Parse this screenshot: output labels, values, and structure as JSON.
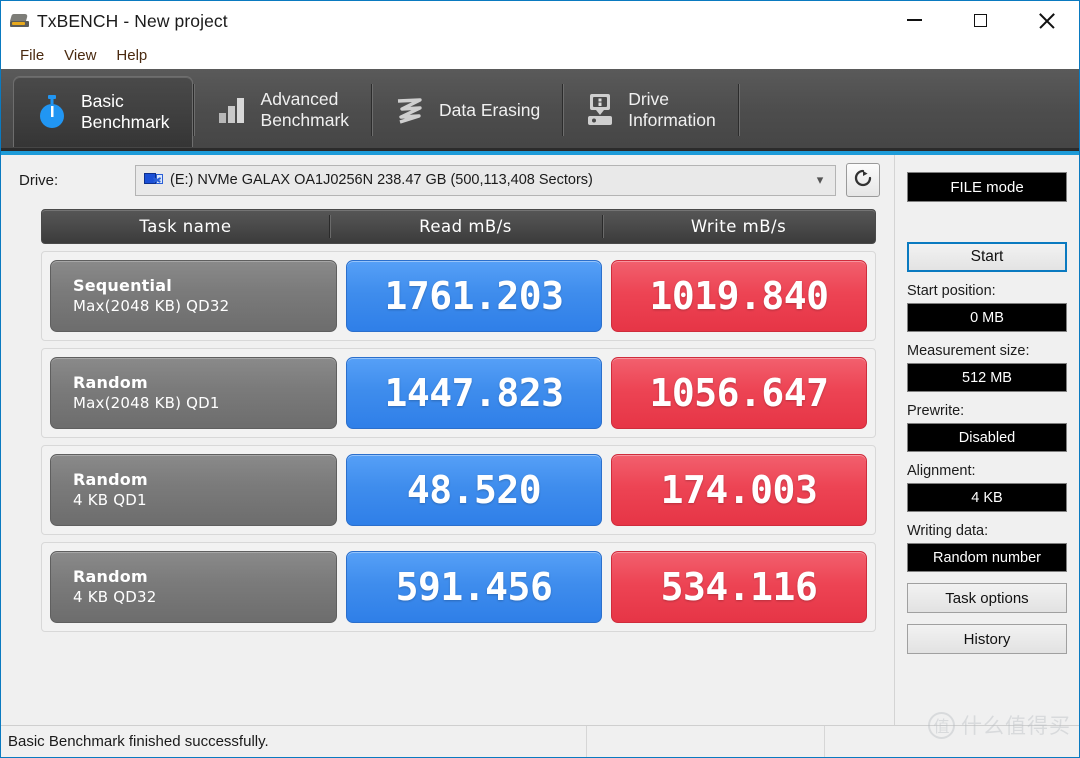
{
  "window": {
    "title": "TxBENCH - New project",
    "icon": "drive-app-icon",
    "controls": {
      "minimize": "minimize-icon",
      "maximize": "maximize-icon",
      "close": "close-icon"
    }
  },
  "menubar": {
    "items": [
      "File",
      "View",
      "Help"
    ]
  },
  "tabs": [
    {
      "icon": "stopwatch-icon",
      "line1": "Basic",
      "line2": "Benchmark",
      "active": true
    },
    {
      "icon": "bar-chart-icon",
      "line1": "Advanced",
      "line2": "Benchmark",
      "active": false
    },
    {
      "icon": "scribble-icon",
      "line1": "Data Erasing",
      "line2": "",
      "active": false
    },
    {
      "icon": "drive-info-icon",
      "line1": "Drive",
      "line2": "Information",
      "active": false
    }
  ],
  "drive": {
    "label": "Drive:",
    "icon": "network-drive-icon",
    "value": "(E:) NVMe GALAX OA1J0256N  238.47 GB (500,113,408 Sectors)",
    "caret": "chevron-down-icon",
    "refresh": "refresh-icon"
  },
  "table": {
    "headers": [
      "Task name",
      "Read mB/s",
      "Write mB/s"
    ],
    "rows": [
      {
        "name_line1": "Sequential",
        "name_line2": "Max(2048 KB) QD32",
        "read": "1761.203",
        "write": "1019.840"
      },
      {
        "name_line1": "Random",
        "name_line2": "Max(2048 KB) QD1",
        "read": "1447.823",
        "write": "1056.647"
      },
      {
        "name_line1": "Random",
        "name_line2": "4 KB QD1",
        "read": "48.520",
        "write": "174.003"
      },
      {
        "name_line1": "Random",
        "name_line2": "4 KB QD32",
        "read": "591.456",
        "write": "534.116"
      }
    ]
  },
  "panel": {
    "mode": "FILE mode",
    "start": "Start",
    "start_position_label": "Start position:",
    "start_position_value": "0 MB",
    "measurement_size_label": "Measurement size:",
    "measurement_size_value": "512 MB",
    "prewrite_label": "Prewrite:",
    "prewrite_value": "Disabled",
    "alignment_label": "Alignment:",
    "alignment_value": "4 KB",
    "writing_data_label": "Writing data:",
    "writing_data_value": "Random number",
    "task_options": "Task options",
    "history": "History"
  },
  "status": {
    "message": "Basic Benchmark finished successfully.",
    "cell2": "",
    "cell3": ""
  },
  "watermark": {
    "mark": "值",
    "text": "什么值得买"
  },
  "colors": {
    "read": "#3f8ded",
    "write": "#ed4454",
    "accent": "#1d9bd8",
    "tabbar": "#4d4d4d",
    "value_box_bg": "#000000"
  }
}
